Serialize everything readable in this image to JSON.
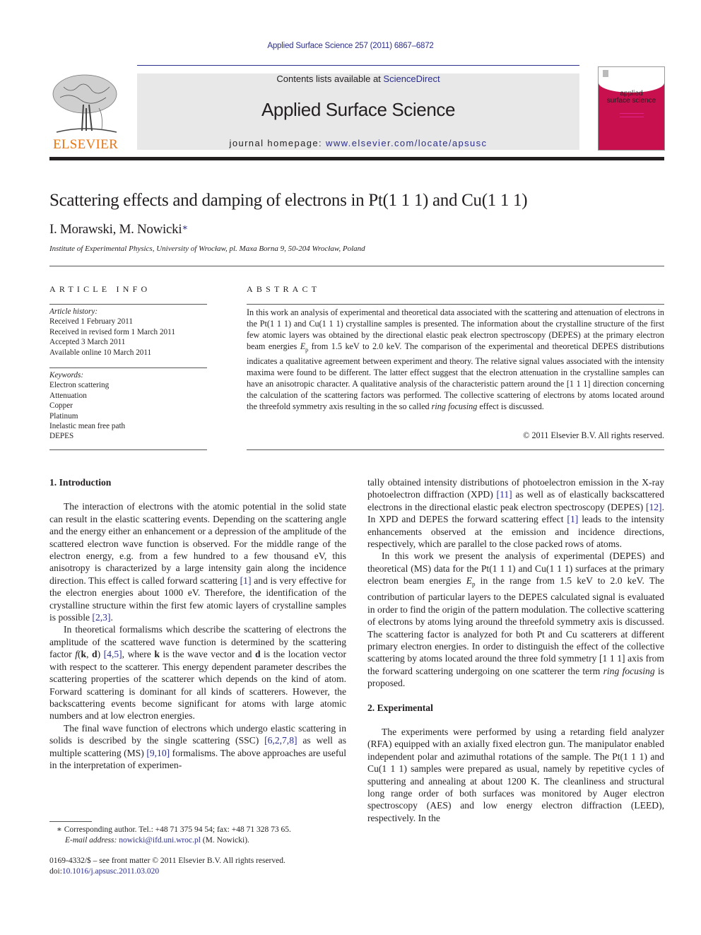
{
  "header": {
    "citation": "Applied Surface Science 257 (2011) 6867–6872",
    "contents_prefix": "Contents lists available at ",
    "contents_link": "ScienceDirect",
    "journal_title": "Applied Surface Science",
    "homepage_prefix": "journal homepage: ",
    "homepage_link": "www.elsevier.com/locate/apsusc",
    "publisher_logo_text": "ELSEVIER",
    "cover": {
      "line1": "applied",
      "line2": "surface science"
    },
    "colors": {
      "link": "#2b2e8c",
      "publisher_orange": "#e87511",
      "cover_magenta": "#c8104f",
      "banner_gray": "#e8e8e8"
    }
  },
  "article": {
    "title": "Scattering effects and damping of electrons in Pt(1 1 1) and Cu(1 1 1)",
    "authors": "I. Morawski, M. Nowicki",
    "author_mark": "∗",
    "affiliation": "Institute of Experimental Physics, University of Wrocław, pl. Maxa Borna 9, 50-204 Wrocław, Poland"
  },
  "article_info": {
    "heading": "ARTICLE INFO",
    "history_label": "Article history:",
    "history": [
      "Received 1 February 2011",
      "Received in revised form 1 March 2011",
      "Accepted 3 March 2011",
      "Available online 10 March 2011"
    ],
    "keywords_label": "Keywords:",
    "keywords": [
      "Electron scattering",
      "Attenuation",
      "Copper",
      "Platinum",
      "Inelastic mean free path",
      "DEPES"
    ]
  },
  "abstract": {
    "heading": "ABSTRACT",
    "text_1": "In this work an analysis of experimental and theoretical data associated with the scattering and attenuation of electrons in the Pt(1 1 1) and Cu(1 1 1) crystalline samples is presented. The information about the crystalline structure of the first few atomic layers was obtained by the directional elastic peak electron spectroscopy (DEPES) at the primary electron beam energies ",
    "ep_symbol": "E",
    "ep_sub": "p",
    "text_2": " from 1.5 keV to 2.0 keV. The comparison of the experimental and theoretical DEPES distributions indicates a qualitative agreement between experiment and theory. The relative signal values associated with the intensity maxima were found to be different. The latter effect suggest that the electron attenuation in the crystalline samples can have an anisotropic character. A qualitative analysis of the characteristic pattern around the [1 1 1] direction concerning the calculation of the scattering factors was performed. The collective scattering of electrons by atoms located around the threefold symmetry axis resulting in the so called ",
    "italic_term": "ring focusing",
    "text_3": " effect is discussed.",
    "copyright": "© 2011 Elsevier B.V. All rights reserved."
  },
  "body": {
    "intro_heading": "1.  Introduction",
    "intro_p1_a": "The interaction of electrons with the atomic potential in the solid state can result in the elastic scattering events. Depending on the scattering angle and the energy either an enhancement or a depression of the amplitude of the scattered electron wave function is observed. For the middle range of the electron energy, e.g. from a few hundred to a few thousand eV, this anisotropy is characterized by a large intensity gain along the incidence direction. This effect is called forward scattering ",
    "ref_1": "[1]",
    "intro_p1_b": " and is very effective for the electron energies about 1000 eV. Therefore, the identification of the crystalline structure within the first few atomic layers of crystalline samples is possible ",
    "ref_2_3": "[2,3]",
    "intro_p2_a": "In theoretical formalisms which describe the scattering of electrons the amplitude of the scattered wave function is determined by the scattering factor ",
    "f_symbol": "f",
    "f_args_open": "(",
    "k_bold": "k",
    "comma": ", ",
    "d_bold": "d",
    "f_args_close": ") ",
    "ref_4_5": "[4,5]",
    "intro_p2_b": ", where ",
    "intro_p2_c": " is the wave vector and ",
    "intro_p2_d": " is the location vector with respect to the scatterer. This energy dependent parameter describes the scattering properties of the scatterer which depends on the kind of atom. Forward scattering is dominant for all kinds of scatterers. However, the backscattering events become significant for atoms with large atomic numbers and at low electron energies.",
    "intro_p3_a": "The final wave function of electrons which undergo elastic scattering in solids is described by the single scattering (SSC) ",
    "ref_6_2_7_8": "[6,2,7,8]",
    "intro_p3_b": " as well as multiple scattering (MS) ",
    "ref_9_10": "[9,10]",
    "intro_p3_c": " formalisms. The above approaches are useful in the interpretation of experimen-",
    "right_p1_a": "tally obtained intensity distributions of photoelectron emission in the X-ray photoelectron diffraction (XPD) ",
    "ref_11": "[11]",
    "right_p1_b": " as well as of elastically backscattered electrons in the directional elastic peak electron spectroscopy (DEPES) ",
    "ref_12": "[12]",
    "right_p1_c": ". In XPD and DEPES the forward scattering effect ",
    "right_p1_d": " leads to the intensity enhancements observed at the emission and incidence directions, respectively, which are parallel to the close packed rows of atoms.",
    "right_p2_a": "In this work we present the analysis of experimental (DEPES) and theoretical (MS) data for the Pt(1 1 1) and Cu(1 1 1) surfaces at the primary electron beam energies ",
    "right_p2_b": " in the range from 1.5 keV to 2.0 keV. The contribution of particular layers to the DEPES calculated signal is evaluated in order to find the origin of the pattern modulation. The collective scattering of electrons by atoms lying around the threefold symmetry axis is discussed. The scattering factor is analyzed for both Pt and Cu scatterers at different primary electron energies. In order to distinguish the effect of the collective scattering by atoms located around the three fold symmetry [1 1 1] axis from the forward scattering undergoing on one scatterer the term ",
    "right_p2_italic": "ring focusing",
    "right_p2_c": " is proposed.",
    "exp_heading": "2.  Experimental",
    "exp_p1": "The experiments were performed by using a retarding field analyzer (RFA) equipped with an axially fixed electron gun. The manipulator enabled independent polar and azimuthal rotations of the sample. The Pt(1 1 1) and Cu(1 1 1) samples were prepared as usual, namely by repetitive cycles of sputtering and annealing at about 1200 K. The cleanliness and structural long range order of both surfaces was monitored by Auger electron spectroscopy (AES) and low energy electron diffraction (LEED), respectively. In the"
  },
  "footnotes": {
    "corresponding": "∗  Corresponding author. Tel.: +48 71 375 94 54; fax: +48 71 328 73 65.",
    "email_label": "E-mail address: ",
    "email": "nowicki@ifd.uni.wroc.pl",
    "email_suffix": " (M. Nowicki).",
    "issn_line": "0169-4332/$ – see front matter © 2011 Elsevier B.V. All rights reserved.",
    "doi_prefix": "doi:",
    "doi": "10.1016/j.apsusc.2011.03.020"
  }
}
